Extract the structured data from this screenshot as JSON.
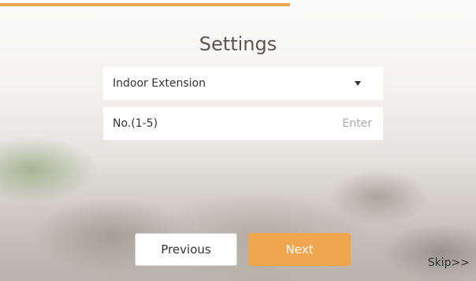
{
  "progress": {
    "percent": 61,
    "color": "#f0a54f"
  },
  "page_title": "Settings",
  "dropdown": {
    "selected": "Indoor Extension",
    "icon": "caret-down-icon"
  },
  "number_field": {
    "label": "No.(1-5)",
    "placeholder": "Enter"
  },
  "buttons": {
    "previous": "Previous",
    "next": "Next",
    "skip": "Skip>>"
  },
  "colors": {
    "accent": "#f0a54f",
    "title": "#5c5550"
  }
}
